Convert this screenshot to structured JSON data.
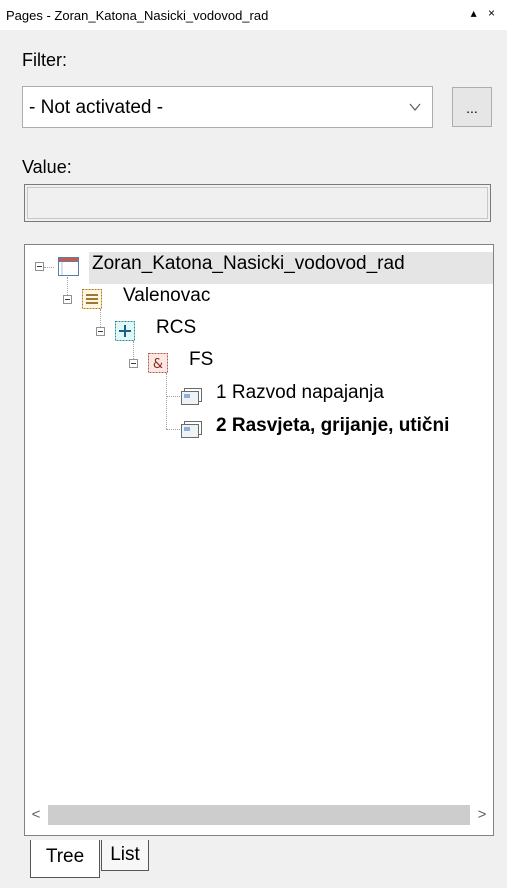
{
  "window": {
    "title": "Pages - Zoran_Katona_Nasicki_vodovod_rad",
    "controls": "▴ ×"
  },
  "filter": {
    "label": "Filter:",
    "selected": "- Not activated -",
    "more_button": "..."
  },
  "value": {
    "label": "Value:",
    "text": ""
  },
  "tree": {
    "nodes": [
      {
        "label": "Zoran_Katona_Nasicki_vodovod_rad",
        "icon": "project-window-icon",
        "bold": false,
        "selected": true
      },
      {
        "label": "Valenovac",
        "icon": "structure-list-icon",
        "bold": false
      },
      {
        "label": "RCS",
        "icon": "plus-box-icon",
        "bold": false
      },
      {
        "label": "FS",
        "icon": "ampersand-box-icon",
        "bold": false
      },
      {
        "label": "1 Razvod napajanja",
        "icon": "page-icon",
        "bold": false
      },
      {
        "label": "2 Rasvjeta, grijanje, utični",
        "icon": "page-icon",
        "bold": true
      }
    ]
  },
  "scrollbar": {
    "left": "<",
    "right": ">"
  },
  "tabs": [
    {
      "label": "Tree",
      "active": true
    },
    {
      "label": "List",
      "active": false
    }
  ]
}
